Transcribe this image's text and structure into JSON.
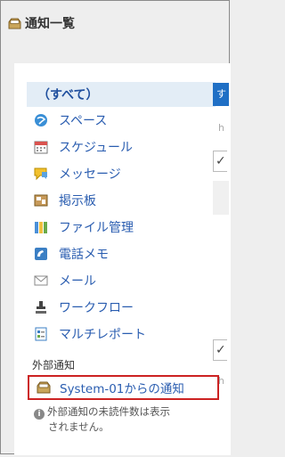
{
  "header": {
    "title": "通知一覧",
    "icon": "inbox-tray-icon"
  },
  "list": {
    "items": [
      {
        "label": "（すべて）",
        "selected": true,
        "icon": ""
      },
      {
        "label": "スペース",
        "icon": "globe-icon"
      },
      {
        "label": "スケジュール",
        "icon": "calendar-icon"
      },
      {
        "label": "メッセージ",
        "icon": "speech-bubble-icon"
      },
      {
        "label": "掲示板",
        "icon": "bulletin-board-icon"
      },
      {
        "label": "ファイル管理",
        "icon": "folder-icon"
      },
      {
        "label": "電話メモ",
        "icon": "phone-memo-icon"
      },
      {
        "label": "メール",
        "icon": "envelope-icon"
      },
      {
        "label": "ワークフロー",
        "icon": "stamp-icon"
      },
      {
        "label": "マルチレポート",
        "icon": "report-icon"
      }
    ],
    "section_label": "外部通知",
    "external": {
      "label": "System-01からの通知",
      "icon": "inbox-tray-icon"
    },
    "note": {
      "line1": "外部通知の未読件数は表示",
      "line2": "されません。",
      "icon_glyph": "i"
    }
  },
  "right_strip": {
    "tab_label": "す",
    "h1": "h",
    "h2": "h",
    "check_glyph": "✓"
  },
  "colors": {
    "accent_blue": "#1f6fc5",
    "link_blue": "#2a5db0",
    "selected_bg": "#e3edf6",
    "highlight_border": "#cc2222"
  }
}
